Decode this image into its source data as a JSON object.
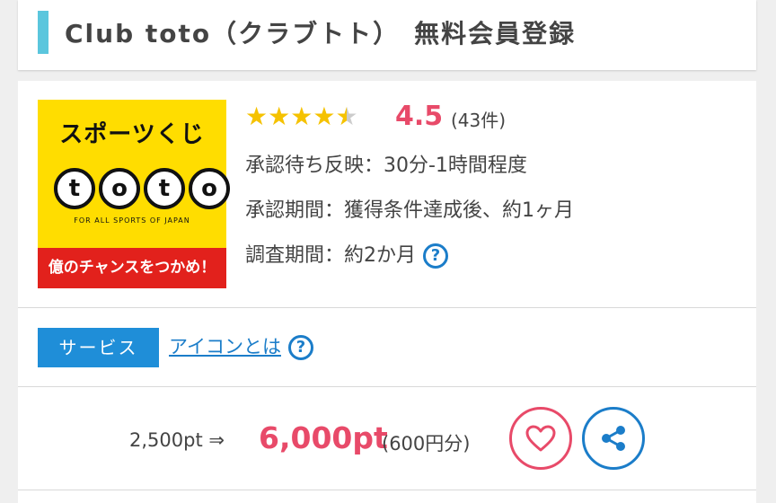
{
  "header": {
    "title": "Club toto（クラブトト）　無料会員登録"
  },
  "logo": {
    "top_text": "スポーツくじ",
    "letters": [
      "t",
      "o",
      "t",
      "o"
    ],
    "sub_text": "FOR ALL SPORTS OF JAPAN",
    "bottom_text": "億のチャンスをつかめ！"
  },
  "rating": {
    "value": "4.5",
    "count": "(43件)",
    "stars_filled": 4.5,
    "stars_max": 5
  },
  "details": {
    "approval_reflect": "承認待ち反映：30分-1時間程度",
    "approval_period": "承認期間：獲得条件達成後、約1ヶ月",
    "survey_period": "調査期間：約2か月"
  },
  "service": {
    "tag": "サービス",
    "icon_link": "アイコンとは"
  },
  "points": {
    "base": "2,500pt ⇒",
    "big": "6,000pt",
    "yen": "(600円分)"
  },
  "colors": {
    "accent_pink": "#e84a69",
    "accent_blue": "#1b7dc9",
    "title_bar": "#5bc6dd",
    "logo_yellow": "#ffdd00"
  }
}
